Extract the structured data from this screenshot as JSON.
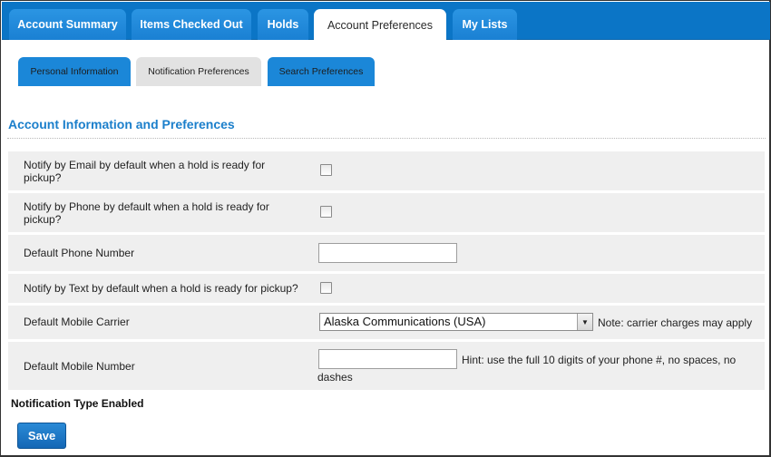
{
  "tabs": [
    {
      "label": "Account Summary"
    },
    {
      "label": "Items Checked Out"
    },
    {
      "label": "Holds"
    },
    {
      "label": "Account Preferences",
      "active": true
    },
    {
      "label": "My Lists"
    }
  ],
  "subtabs": [
    {
      "label": "Personal Information"
    },
    {
      "label": "Notification Preferences",
      "active": true
    },
    {
      "label": "Search Preferences"
    }
  ],
  "section": {
    "title": "Account Information and Preferences"
  },
  "form": {
    "email_hold": {
      "label_line1": "Notify by Email by default when a hold is ready for",
      "label_line2": "pickup?",
      "checked": false
    },
    "phone_hold": {
      "label_line1": "Notify by Phone by default when a hold is ready for",
      "label_line2": "pickup?",
      "checked": false
    },
    "default_phone": {
      "label": "Default Phone Number",
      "value": ""
    },
    "text_hold": {
      "label": "Notify by Text by default when a hold is ready for pickup?",
      "checked": false
    },
    "mobile_carrier": {
      "label": "Default Mobile Carrier",
      "selected": "Alaska Communications (USA)",
      "note": "Note: carrier charges may apply"
    },
    "mobile_number": {
      "label": "Default Mobile Number",
      "value": "",
      "hint_line1": "Hint: use the full 10 digits of your phone #, no spaces, no",
      "hint_line2": "dashes"
    }
  },
  "notification_type_heading": "Notification Type Enabled",
  "save_label": "Save",
  "colors": {
    "tab_bar": "#0b75c6",
    "tab": "#1a80d3",
    "accent_title": "#1b7fcb",
    "row_bg": "#efefef",
    "save": "#1467b5"
  }
}
